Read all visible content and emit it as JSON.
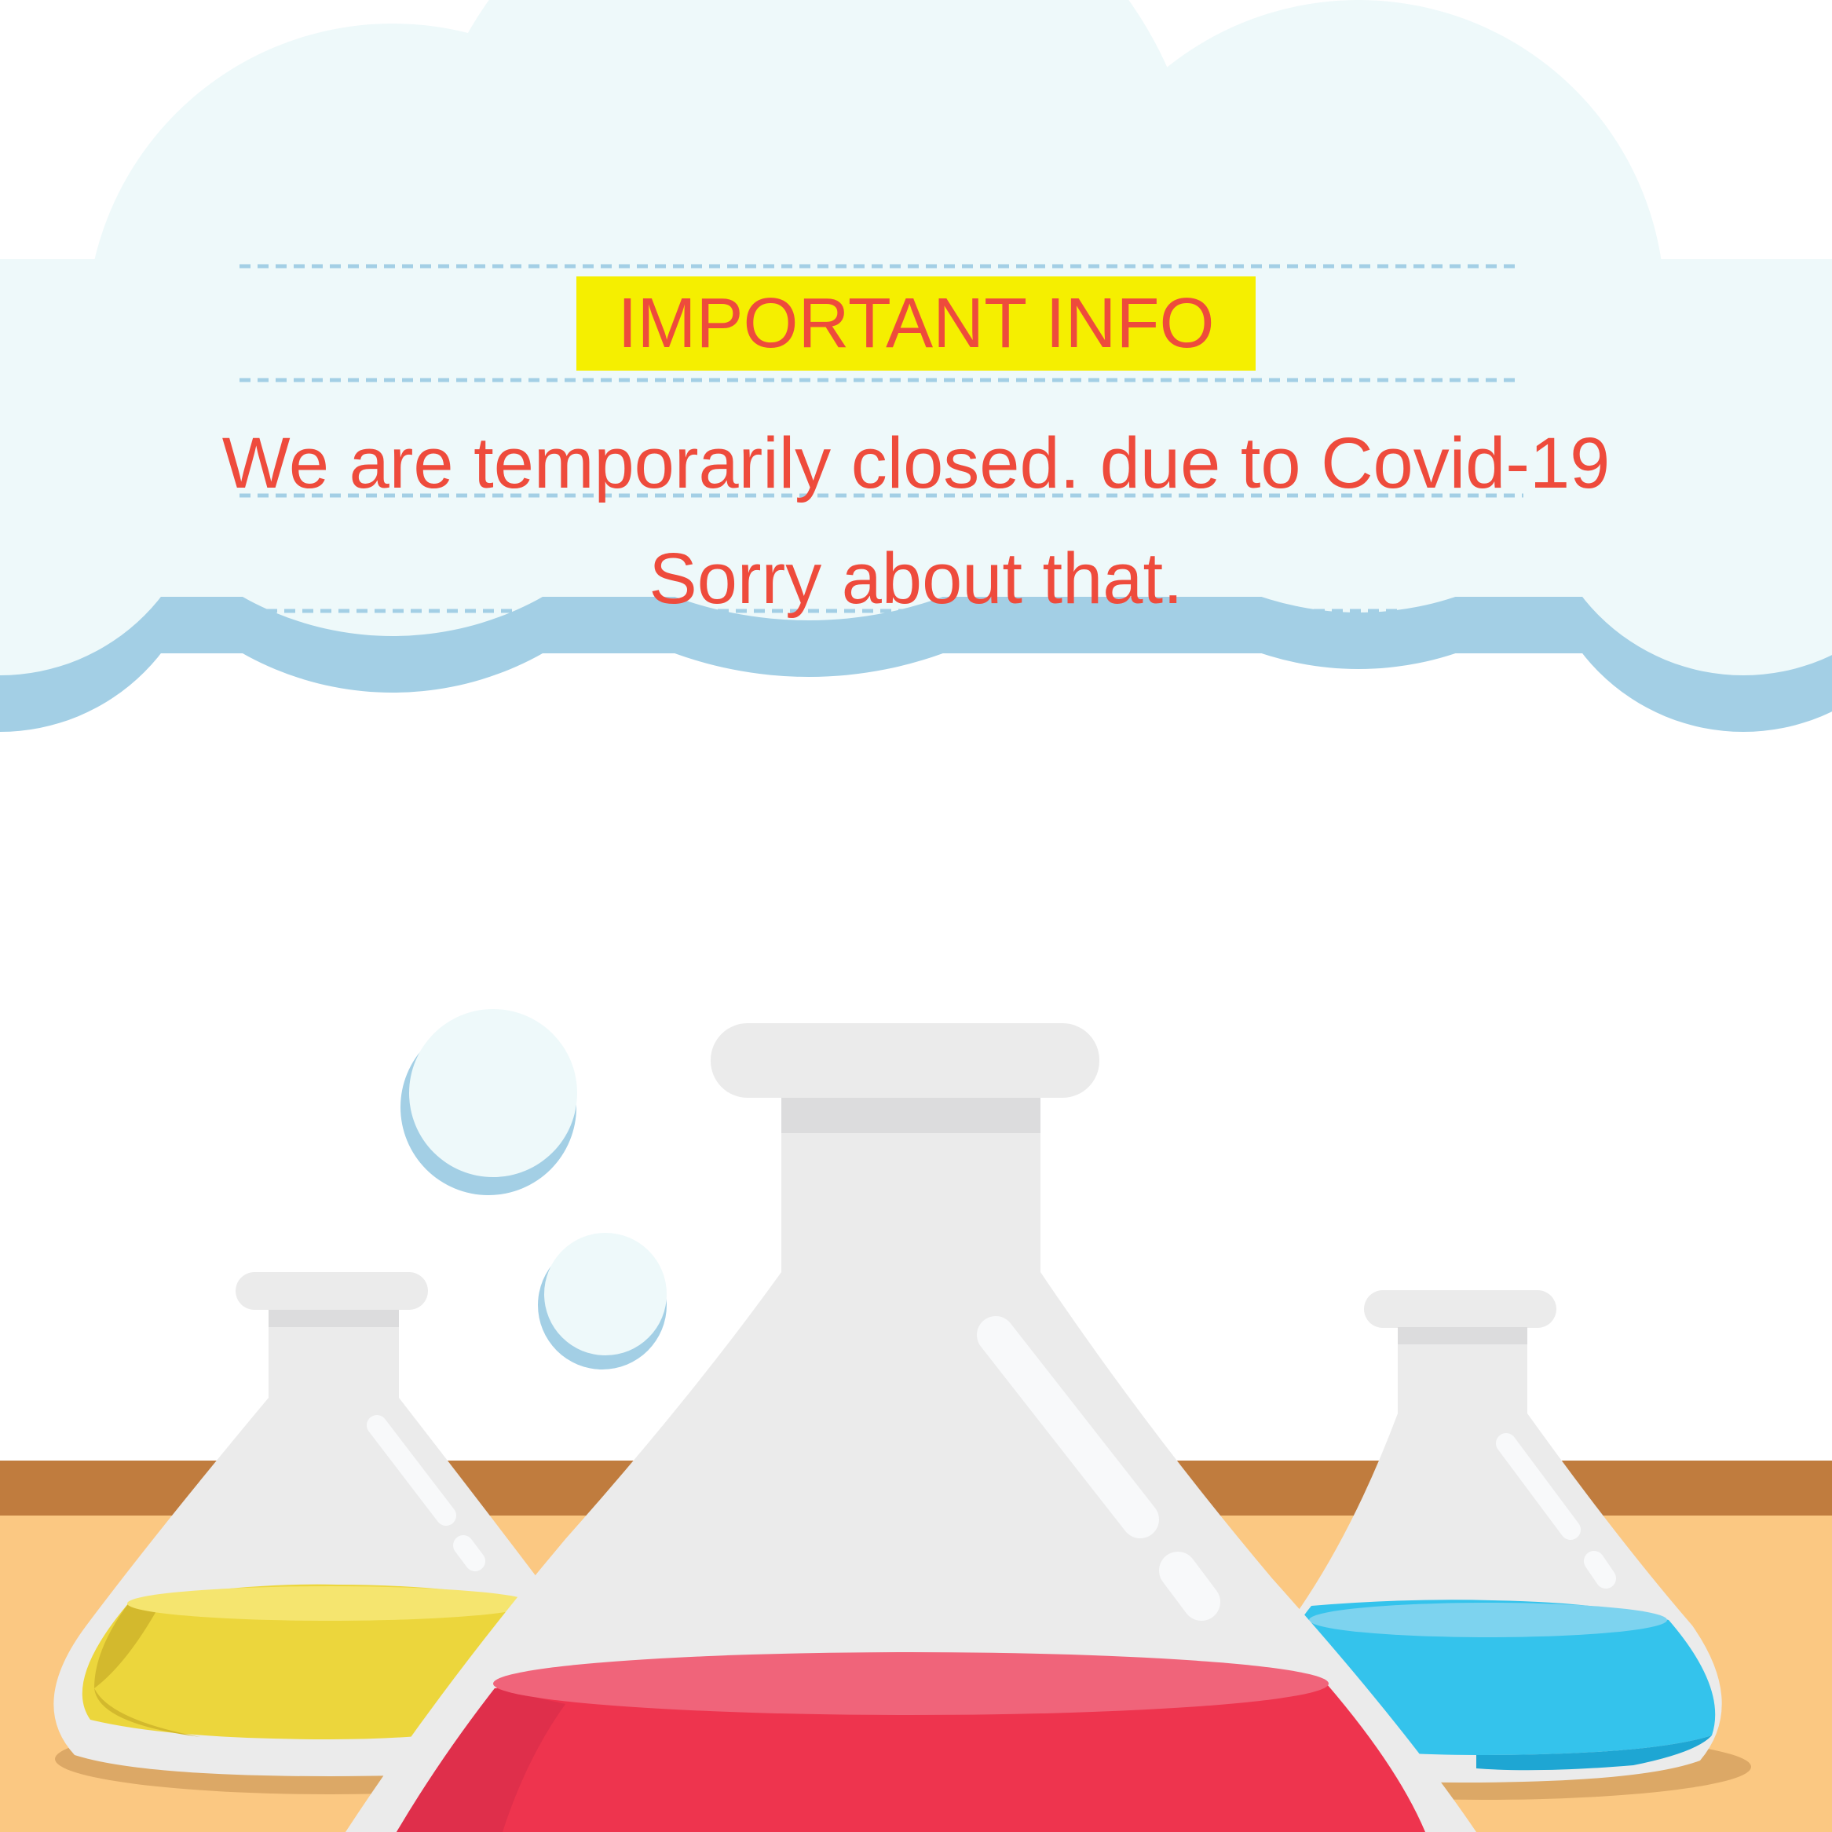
{
  "notice": {
    "heading": "IMPORTANT INFO",
    "line1": "We are temporarily closed. due to Covid-19",
    "line2": "Sorry about that."
  },
  "colors": {
    "heading_highlight": "#f5ef00",
    "text": "#ee4b3c",
    "cloud": "#eef9fa",
    "cloud_shadow": "#a3cfe5",
    "table_top": "#c07c3e",
    "table_front": "#fbc882",
    "flask_glass": "#ebebeb",
    "liquid_yellow": "#ecd63c",
    "liquid_red": "#ee344e",
    "liquid_blue": "#34c3ec"
  },
  "icons": [
    "cloud-icon",
    "bubble-icon",
    "flask-icon"
  ]
}
